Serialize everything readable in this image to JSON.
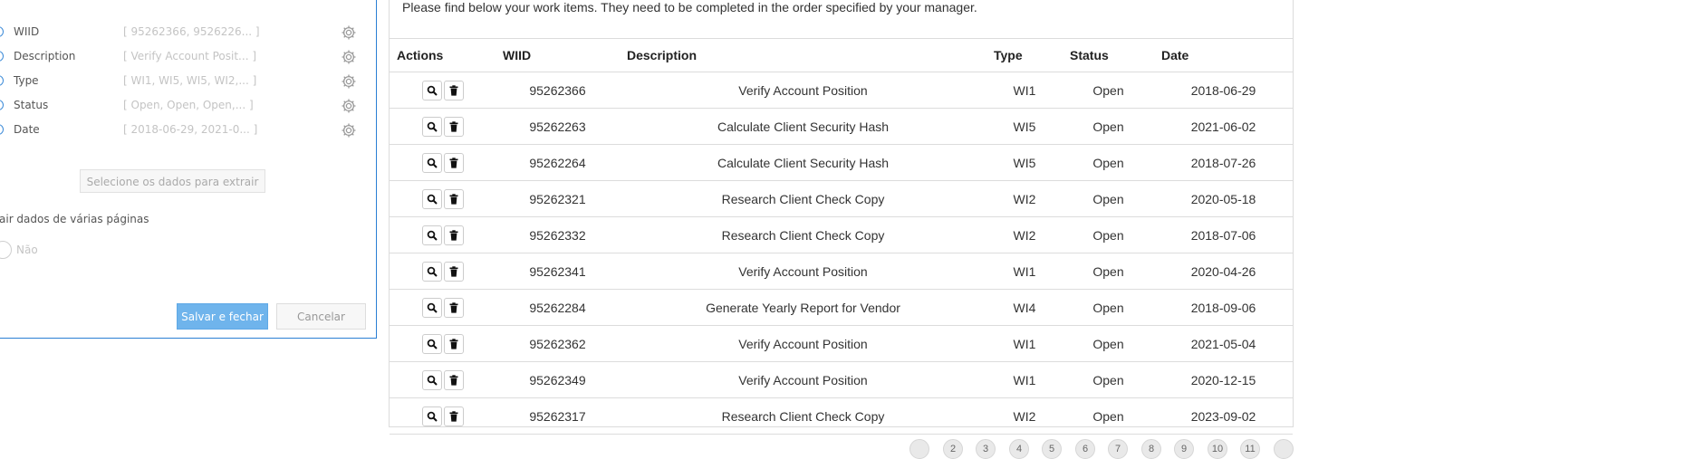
{
  "dialog": {
    "fields": [
      {
        "name": "WIID",
        "value": "[ 95262366, 9526226... ]"
      },
      {
        "name": "Description",
        "value": "[ Verify Account Posit... ]"
      },
      {
        "name": "Type",
        "value": "[ WI1, WI5, WI5, WI2,... ]"
      },
      {
        "name": "Status",
        "value": "[ Open, Open, Open,... ]"
      },
      {
        "name": "Date",
        "value": "[ 2018-06-29, 2021-0... ]"
      }
    ],
    "select_data_button": "Selecione os dados para extrair",
    "multi_page_label": "air dados de várias páginas",
    "multi_page_value": "Não",
    "save_button": "Salvar e fechar",
    "cancel_button": "Cancelar"
  },
  "main": {
    "instructions": "Please find below your work items. They need to be completed in the order specified by your manager.",
    "columns": {
      "actions": "Actions",
      "wiid": "WIID",
      "description": "Description",
      "type": "Type",
      "status": "Status",
      "date": "Date"
    },
    "rows": [
      {
        "wiid": "95262366",
        "description": "Verify Account Position",
        "type": "WI1",
        "status": "Open",
        "date": "2018-06-29"
      },
      {
        "wiid": "95262263",
        "description": "Calculate Client Security Hash",
        "type": "WI5",
        "status": "Open",
        "date": "2021-06-02"
      },
      {
        "wiid": "95262264",
        "description": "Calculate Client Security Hash",
        "type": "WI5",
        "status": "Open",
        "date": "2018-07-26"
      },
      {
        "wiid": "95262321",
        "description": "Research Client Check Copy",
        "type": "WI2",
        "status": "Open",
        "date": "2020-05-18"
      },
      {
        "wiid": "95262332",
        "description": "Research Client Check Copy",
        "type": "WI2",
        "status": "Open",
        "date": "2018-07-06"
      },
      {
        "wiid": "95262341",
        "description": "Verify Account Position",
        "type": "WI1",
        "status": "Open",
        "date": "2020-04-26"
      },
      {
        "wiid": "95262284",
        "description": "Generate Yearly Report for Vendor",
        "type": "WI4",
        "status": "Open",
        "date": "2018-09-06"
      },
      {
        "wiid": "95262362",
        "description": "Verify Account Position",
        "type": "WI1",
        "status": "Open",
        "date": "2021-05-04"
      },
      {
        "wiid": "95262349",
        "description": "Verify Account Position",
        "type": "WI1",
        "status": "Open",
        "date": "2020-12-15"
      },
      {
        "wiid": "95262317",
        "description": "Research Client Check Copy",
        "type": "WI2",
        "status": "Open",
        "date": "2023-09-02"
      }
    ],
    "pagination": [
      "",
      "2",
      "3",
      "4",
      "5",
      "6",
      "7",
      "8",
      "9",
      "10",
      "11",
      ""
    ]
  },
  "colors": {
    "dialog_border": "#2a7fd4",
    "save_button_bg": "#6fb4ec",
    "grid_border": "#dcdcdc"
  },
  "icons": {
    "view": "magnifier-icon",
    "delete": "trash-icon",
    "field_settings": "gear-icon"
  }
}
